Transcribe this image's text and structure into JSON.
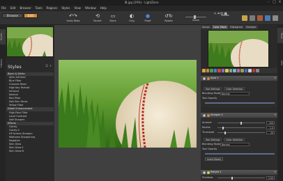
{
  "window": {
    "title": "IB.jpg (29%) - LightZone"
  },
  "menu": [
    "File",
    "Edit",
    "Browser",
    "Tools",
    "Regions",
    "Styles",
    "View",
    "Window",
    "Help"
  ],
  "modes_buttons": {
    "browse": "Browse",
    "edit": "Edit"
  },
  "toolbar": {
    "undo_redo": "Undo Redo",
    "revert": "Revert",
    "done": "Done",
    "orig": "Orig",
    "proof": "Proof",
    "rotate": "Rotate",
    "zoom": "Zoom",
    "modes": "Modes"
  },
  "left_tabs": {
    "styles": "Styles",
    "history": "History"
  },
  "styles_panel": {
    "title": "Styles",
    "items": [
      {
        "label": "Black & White",
        "group": true
      },
      {
        "label": "Alien Infrared"
      },
      {
        "label": "Blue Filter"
      },
      {
        "label": "Channel Mixer"
      },
      {
        "label": "High Key Portrait"
      },
      {
        "label": "Infrared"
      },
      {
        "label": "Normal"
      },
      {
        "label": "Red Filter"
      },
      {
        "label": "Soft Skin Tones"
      },
      {
        "label": "Yellow Filter"
      },
      {
        "label": "Detail Enhancement",
        "group": true
      },
      {
        "label": "High-Pass Filter"
      },
      {
        "label": "Local Contrast"
      },
      {
        "label": "Soft Sharpen"
      },
      {
        "label": "Effects",
        "group": true
      },
      {
        "label": "Clarity"
      },
      {
        "label": "Clarity II"
      },
      {
        "label": "HP Screen Sharpen"
      },
      {
        "label": "Midtones Sharpening"
      },
      {
        "label": "Negative"
      },
      {
        "label": "Skin Glow"
      },
      {
        "label": "Skin Glow II"
      },
      {
        "label": "Skin Glow III"
      }
    ]
  },
  "right_tabs": {
    "tabs": [
      "Zones",
      "Color Mask",
      "Histogram",
      "Sampler"
    ],
    "active": "Color Mask"
  },
  "right_vertical_tabs": {
    "tools": "Tools",
    "info": "Info"
  },
  "tools": {
    "spot": {
      "name": "Spot 1",
      "subtabs": [
        "Tool Settings",
        "Color Selection"
      ],
      "blending_label": "Blending Mode",
      "blending_value": "Normal",
      "opacity_label": "Tool Opacity"
    },
    "sharpen": {
      "name": "Sharpen 1",
      "amount_label": "Amount",
      "amount_value": "100",
      "amount_frac": 0.5,
      "radius_label": "Radius",
      "radius_value": "1.0",
      "radius_frac": 0.1,
      "threshold_label": "Threshold",
      "threshold_value": "20",
      "threshold_frac": 0.15,
      "subtabs": [
        "Tool Settings",
        "Color Selection"
      ],
      "blending_label": "Blending Mode",
      "blending_value": "Normal",
      "opacity_label": "Tool Opacity",
      "insert_masks": "Insert Masks"
    },
    "relight": {
      "name": "Relight 1",
      "shadows_label": "Shadows",
      "shadows_value": "3.00",
      "shadows_frac": 0.3
    }
  },
  "colors": {
    "accent": "#d08a3a",
    "selected": "#4a5a78"
  }
}
